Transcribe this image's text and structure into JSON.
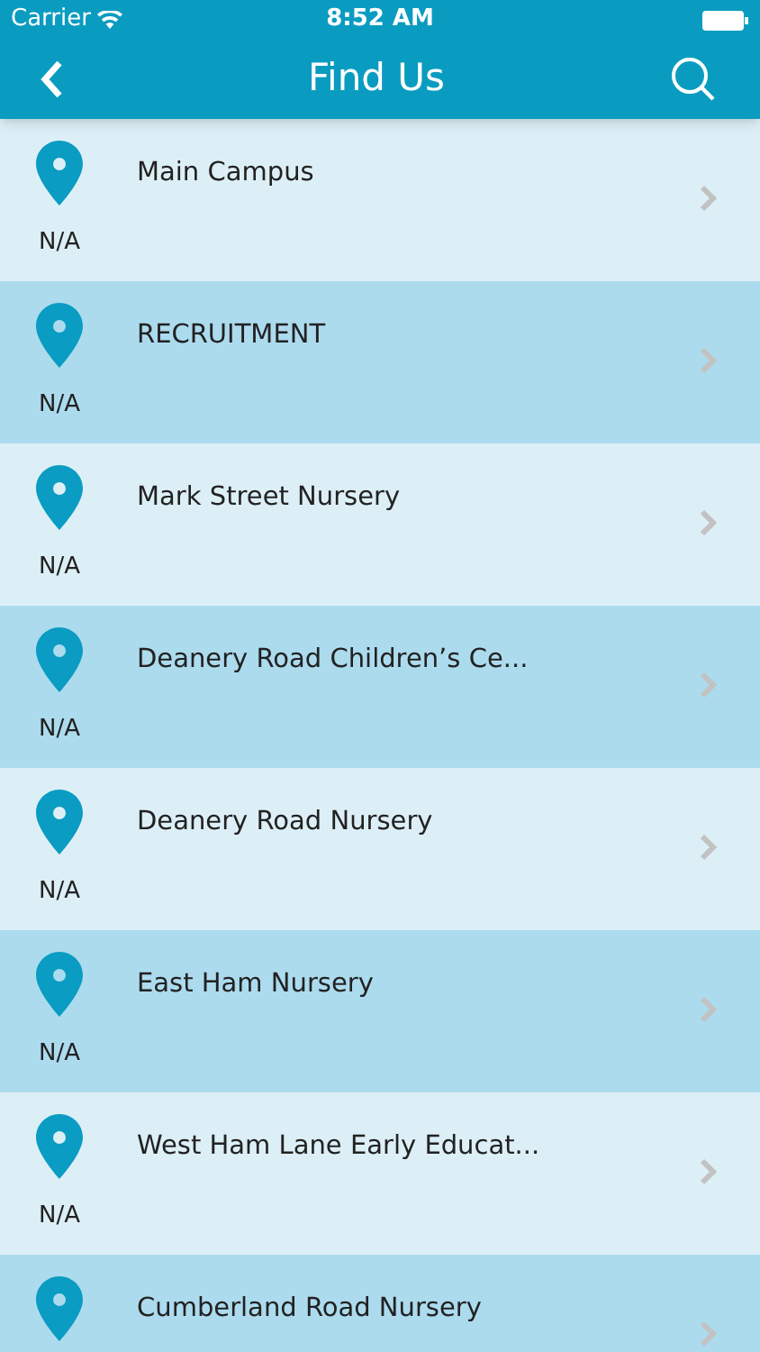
{
  "status_bar": {
    "carrier": "Carrier",
    "time": "8:52 AM"
  },
  "nav": {
    "title": "Find Us"
  },
  "locations": [
    {
      "name": "Main Campus",
      "distance": "N/A"
    },
    {
      "name": "RECRUITMENT",
      "distance": "N/A"
    },
    {
      "name": "Mark Street Nursery",
      "distance": "N/A"
    },
    {
      "name": "Deanery Road Children’s Ce...",
      "distance": "N/A"
    },
    {
      "name": "Deanery Road Nursery",
      "distance": "N/A"
    },
    {
      "name": "East Ham Nursery",
      "distance": "N/A"
    },
    {
      "name": "West Ham Lane Early Educat...",
      "distance": "N/A"
    },
    {
      "name": "Cumberland Road Nursery"
    }
  ]
}
